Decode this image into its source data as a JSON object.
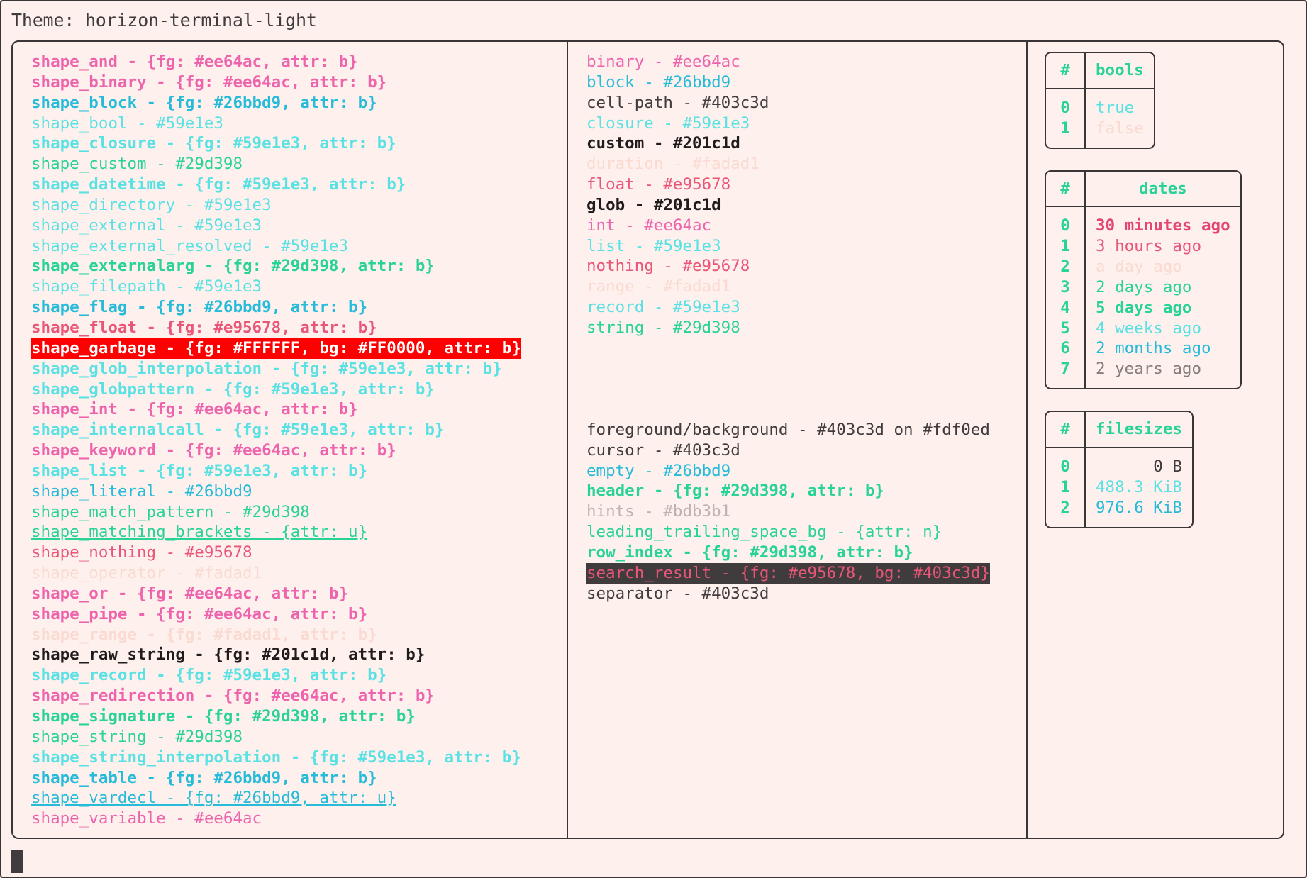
{
  "theme": {
    "label": "Theme: horizon-terminal-light",
    "name": "horizon-terminal-light"
  },
  "palette": {
    "background": "#fdf0ed",
    "foreground": "#403c3d",
    "pink": "#ee64ac",
    "blue": "#26bbd9",
    "cyan": "#59e1e3",
    "green": "#29d398",
    "red": "#e95678",
    "black": "#201c1d",
    "faint": "#fadad1",
    "gray": "#bdb3b1",
    "dark": "#403c3d",
    "garbage_fg": "#FFFFFF",
    "garbage_bg": "#FF0000"
  },
  "shapes": [
    {
      "text": "shape_and - {fg: #ee64ac, attr: b}",
      "fg": "#ee64ac",
      "bold": true
    },
    {
      "text": "shape_binary - {fg: #ee64ac, attr: b}",
      "fg": "#ee64ac",
      "bold": true
    },
    {
      "text": "shape_block - {fg: #26bbd9, attr: b}",
      "fg": "#26bbd9",
      "bold": true
    },
    {
      "text": "shape_bool - #59e1e3",
      "fg": "#59e1e3",
      "bold": false
    },
    {
      "text": "shape_closure - {fg: #59e1e3, attr: b}",
      "fg": "#59e1e3",
      "bold": true
    },
    {
      "text": "shape_custom - #29d398",
      "fg": "#29d398",
      "bold": false
    },
    {
      "text": "shape_datetime - {fg: #59e1e3, attr: b}",
      "fg": "#59e1e3",
      "bold": true
    },
    {
      "text": "shape_directory - #59e1e3",
      "fg": "#59e1e3",
      "bold": false
    },
    {
      "text": "shape_external - #59e1e3",
      "fg": "#59e1e3",
      "bold": false
    },
    {
      "text": "shape_external_resolved - #59e1e3",
      "fg": "#59e1e3",
      "bold": false
    },
    {
      "text": "shape_externalarg - {fg: #29d398, attr: b}",
      "fg": "#29d398",
      "bold": true
    },
    {
      "text": "shape_filepath - #59e1e3",
      "fg": "#59e1e3",
      "bold": false
    },
    {
      "text": "shape_flag - {fg: #26bbd9, attr: b}",
      "fg": "#26bbd9",
      "bold": true
    },
    {
      "text": "shape_float - {fg: #e95678, attr: b}",
      "fg": "#e95678",
      "bold": true
    },
    {
      "text": "shape_garbage - {fg: #FFFFFF, bg: #FF0000, attr: b}",
      "fg": "#FFFFFF",
      "bg": "#FF0000",
      "bold": true
    },
    {
      "text": "shape_glob_interpolation - {fg: #59e1e3, attr: b}",
      "fg": "#59e1e3",
      "bold": true
    },
    {
      "text": "shape_globpattern - {fg: #59e1e3, attr: b}",
      "fg": "#59e1e3",
      "bold": true
    },
    {
      "text": "shape_int - {fg: #ee64ac, attr: b}",
      "fg": "#ee64ac",
      "bold": true
    },
    {
      "text": "shape_internalcall - {fg: #59e1e3, attr: b}",
      "fg": "#59e1e3",
      "bold": true
    },
    {
      "text": "shape_keyword - {fg: #ee64ac, attr: b}",
      "fg": "#ee64ac",
      "bold": true
    },
    {
      "text": "shape_list - {fg: #59e1e3, attr: b}",
      "fg": "#59e1e3",
      "bold": true
    },
    {
      "text": "shape_literal - #26bbd9",
      "fg": "#26bbd9",
      "bold": false
    },
    {
      "text": "shape_match_pattern - #29d398",
      "fg": "#29d398",
      "bold": false
    },
    {
      "text": "shape_matching_brackets - {attr: u}",
      "fg": "#29d398",
      "bold": false,
      "underline": true
    },
    {
      "text": "shape_nothing - #e95678",
      "fg": "#e95678",
      "bold": false
    },
    {
      "text": "shape_operator - #fadad1",
      "fg": "#fadad1",
      "bold": false
    },
    {
      "text": "shape_or - {fg: #ee64ac, attr: b}",
      "fg": "#ee64ac",
      "bold": true
    },
    {
      "text": "shape_pipe - {fg: #ee64ac, attr: b}",
      "fg": "#ee64ac",
      "bold": true
    },
    {
      "text": "shape_range - {fg: #fadad1, attr: b}",
      "fg": "#fadad1",
      "bold": true
    },
    {
      "text": "shape_raw_string - {fg: #201c1d, attr: b}",
      "fg": "#201c1d",
      "bold": true
    },
    {
      "text": "shape_record - {fg: #59e1e3, attr: b}",
      "fg": "#59e1e3",
      "bold": true
    },
    {
      "text": "shape_redirection - {fg: #ee64ac, attr: b}",
      "fg": "#ee64ac",
      "bold": true
    },
    {
      "text": "shape_signature - {fg: #29d398, attr: b}",
      "fg": "#29d398",
      "bold": true
    },
    {
      "text": "shape_string - #29d398",
      "fg": "#29d398",
      "bold": false
    },
    {
      "text": "shape_string_interpolation - {fg: #59e1e3, attr: b}",
      "fg": "#59e1e3",
      "bold": true
    },
    {
      "text": "shape_table - {fg: #26bbd9, attr: b}",
      "fg": "#26bbd9",
      "bold": true
    },
    {
      "text": "shape_vardecl - {fg: #26bbd9, attr: u}",
      "fg": "#26bbd9",
      "bold": false,
      "underline": true
    },
    {
      "text": "shape_variable - #ee64ac",
      "fg": "#ee64ac",
      "bold": false
    }
  ],
  "types": [
    {
      "text": "binary - #ee64ac",
      "fg": "#ee64ac",
      "bold": false
    },
    {
      "text": "block - #26bbd9",
      "fg": "#26bbd9",
      "bold": false
    },
    {
      "text": "cell-path - #403c3d",
      "fg": "#403c3d",
      "bold": false
    },
    {
      "text": "closure - #59e1e3",
      "fg": "#59e1e3",
      "bold": false
    },
    {
      "text": "custom - #201c1d",
      "fg": "#201c1d",
      "bold": true
    },
    {
      "text": "duration - #fadad1",
      "fg": "#fadad1",
      "bold": false
    },
    {
      "text": "float - #e95678",
      "fg": "#e95678",
      "bold": false
    },
    {
      "text": "glob - #201c1d",
      "fg": "#201c1d",
      "bold": true
    },
    {
      "text": "int - #ee64ac",
      "fg": "#ee64ac",
      "bold": false
    },
    {
      "text": "list - #59e1e3",
      "fg": "#59e1e3",
      "bold": false
    },
    {
      "text": "nothing - #e95678",
      "fg": "#e95678",
      "bold": false
    },
    {
      "text": "range - #fadad1",
      "fg": "#fadad1",
      "bold": false
    },
    {
      "text": "record - #59e1e3",
      "fg": "#59e1e3",
      "bold": false
    },
    {
      "text": "string - #29d398",
      "fg": "#29d398",
      "bold": false
    }
  ],
  "ui_elements": [
    {
      "text": "foreground/background - #403c3d on #fdf0ed",
      "fg": "#403c3d",
      "bold": false
    },
    {
      "text": "cursor - #403c3d",
      "fg": "#403c3d",
      "bold": false
    },
    {
      "text": "empty - #26bbd9",
      "fg": "#26bbd9",
      "bold": false
    },
    {
      "text": "header - {fg: #29d398, attr: b}",
      "fg": "#29d398",
      "bold": true
    },
    {
      "text": "hints - #bdb3b1",
      "fg": "#bdb3b1",
      "bold": false
    },
    {
      "text": "leading_trailing_space_bg - {attr: n}",
      "fg": "#29d398",
      "bold": false
    },
    {
      "text": "row_index - {fg: #29d398, attr: b}",
      "fg": "#29d398",
      "bold": true
    },
    {
      "text": "search_result - {fg: #e95678, bg: #403c3d}",
      "fg": "#e95678",
      "bg": "#403c3d",
      "bold": false
    },
    {
      "text": "separator - #403c3d",
      "fg": "#403c3d",
      "bold": false
    }
  ],
  "tables": [
    {
      "name": "bools",
      "index_header": "#",
      "value_header": "bools",
      "align": "left",
      "rows": [
        {
          "index": "0",
          "value": "true",
          "fg": "#59e1e3",
          "bold": false
        },
        {
          "index": "1",
          "value": "false",
          "fg": "#fadad1",
          "bold": false
        }
      ]
    },
    {
      "name": "dates",
      "index_header": "#",
      "value_header": "dates",
      "align": "left",
      "rows": [
        {
          "index": "0",
          "value": "30 minutes ago",
          "fg": "#e3456f",
          "bold": true
        },
        {
          "index": "1",
          "value": "3 hours ago",
          "fg": "#e95678",
          "bold": false
        },
        {
          "index": "2",
          "value": "a day ago",
          "fg": "#fadad1",
          "bold": false
        },
        {
          "index": "3",
          "value": "2 days ago",
          "fg": "#29d398",
          "bold": false
        },
        {
          "index": "4",
          "value": "5 days ago",
          "fg": "#29d398",
          "bold": true
        },
        {
          "index": "5",
          "value": "4 weeks ago",
          "fg": "#59e1e3",
          "bold": false
        },
        {
          "index": "6",
          "value": "2 months ago",
          "fg": "#26bbd9",
          "bold": false
        },
        {
          "index": "7",
          "value": "2 years ago",
          "fg": "#847d7c",
          "bold": false
        }
      ]
    },
    {
      "name": "filesizes",
      "index_header": "#",
      "value_header": "filesizes",
      "align": "right",
      "rows": [
        {
          "index": "0",
          "value": "0 B",
          "fg": "#403c3d",
          "bold": false
        },
        {
          "index": "1",
          "value": "488.3 KiB",
          "fg": "#59e1e3",
          "bold": false
        },
        {
          "index": "2",
          "value": "976.6 KiB",
          "fg": "#26bbd9",
          "bold": false
        }
      ]
    }
  ],
  "prompt": {
    "cursor": "block"
  }
}
